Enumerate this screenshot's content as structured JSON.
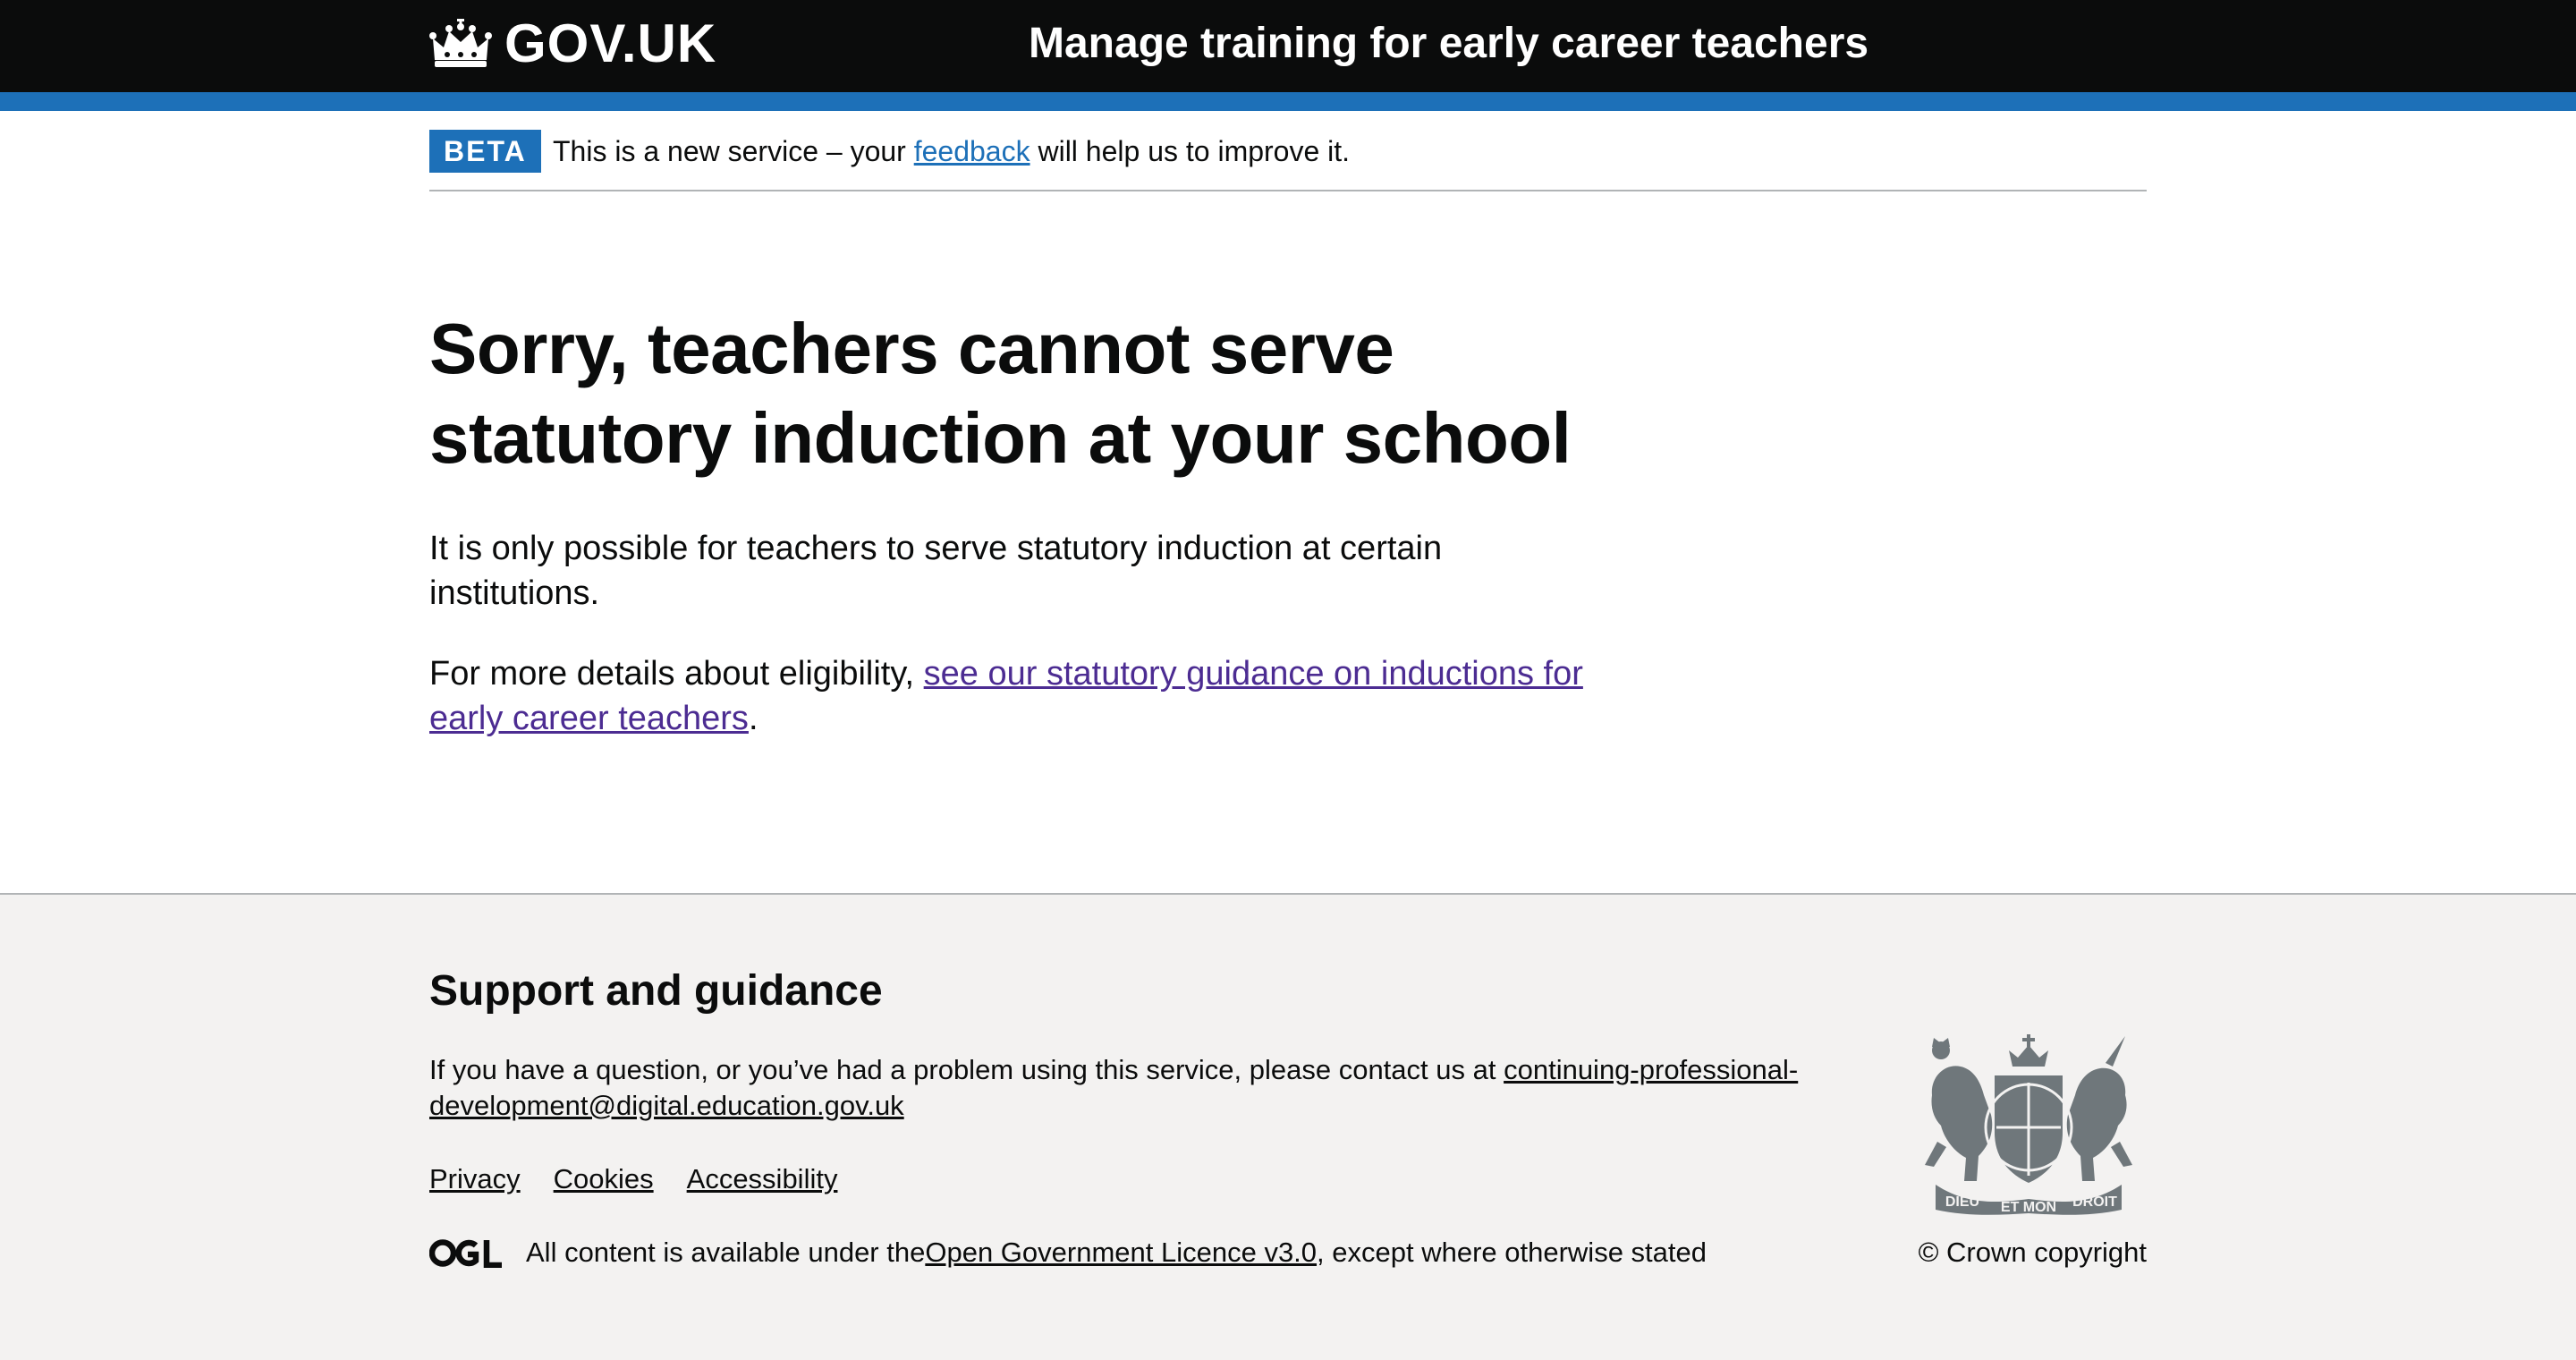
{
  "header": {
    "logo_text": "GOV.UK",
    "service_name": "Manage training for early career teachers"
  },
  "phase_banner": {
    "tag": "BETA",
    "text_before": "This is a new service – your ",
    "link": "feedback",
    "text_after": " will help us to improve it."
  },
  "main": {
    "heading": "Sorry, teachers cannot serve statutory induction at your school",
    "para1": "It is only possible for teachers to serve statutory induction at certain institutions.",
    "para2_before": "For more details about eligibility, ",
    "para2_link": "see our statutory guidance on inductions for early career teachers",
    "para2_after": "."
  },
  "footer": {
    "heading": "Support and guidance",
    "support_text": "If you have a question, or you’ve had a problem using this service, please contact us at ",
    "support_email": "continuing-professional-development@digital.education.gov.uk",
    "links": [
      "Privacy",
      "Cookies",
      "Accessibility"
    ],
    "licence_before": "All content is available under the ",
    "licence_link": "Open Government Licence v3.0",
    "licence_after": ", except where otherwise stated",
    "copyright": "© Crown copyright",
    "crest_text": [
      "DIEU",
      "ET MON",
      "DROIT"
    ]
  },
  "colors": {
    "header_bg": "#0b0c0c",
    "brand_blue": "#1d70b8",
    "visited_link": "#4c2c92",
    "footer_bg": "#f3f2f1",
    "crest_grey": "#6f777b"
  },
  "icons": {
    "logo": "crown-icon",
    "licence": "ogl-logo-icon",
    "crest": "royal-coat-of-arms"
  }
}
